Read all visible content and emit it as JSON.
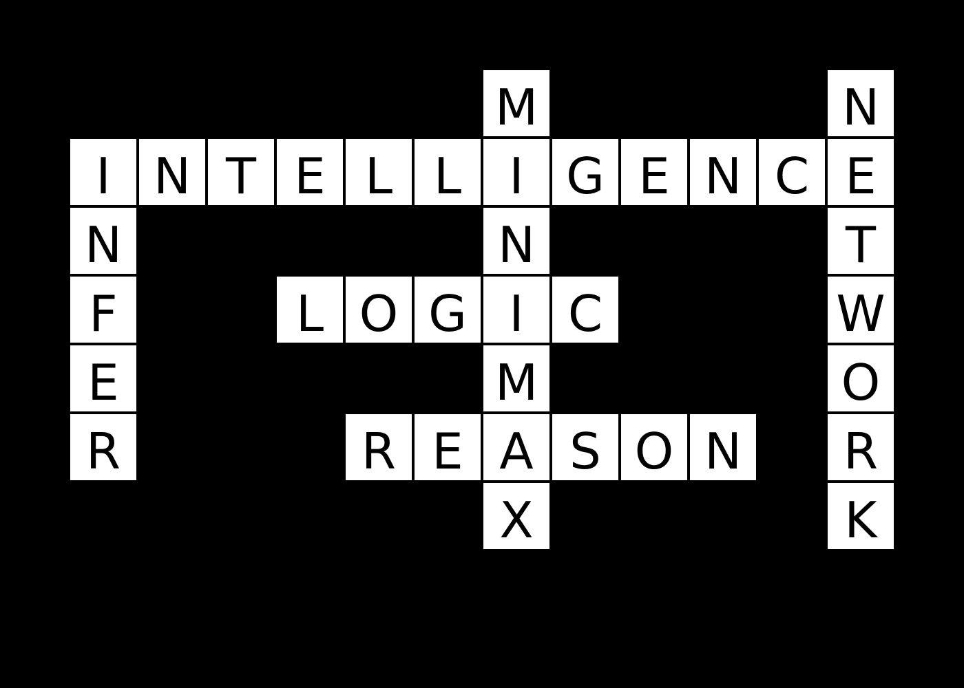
{
  "colors": {
    "background": "#000000",
    "cell": "#ffffff",
    "letter": "#000000"
  },
  "crossword": {
    "words": [
      {
        "word": "INTELLIGENCE",
        "direction": "across",
        "row": 2,
        "col": 1
      },
      {
        "word": "LOGIC",
        "direction": "across",
        "row": 4,
        "col": 4
      },
      {
        "word": "REASON",
        "direction": "across",
        "row": 6,
        "col": 5
      },
      {
        "word": "INFER",
        "direction": "down",
        "row": 2,
        "col": 1
      },
      {
        "word": "MINIMAX",
        "direction": "down",
        "row": 1,
        "col": 7
      },
      {
        "word": "NETWORK",
        "direction": "down",
        "row": 1,
        "col": 12
      }
    ]
  }
}
